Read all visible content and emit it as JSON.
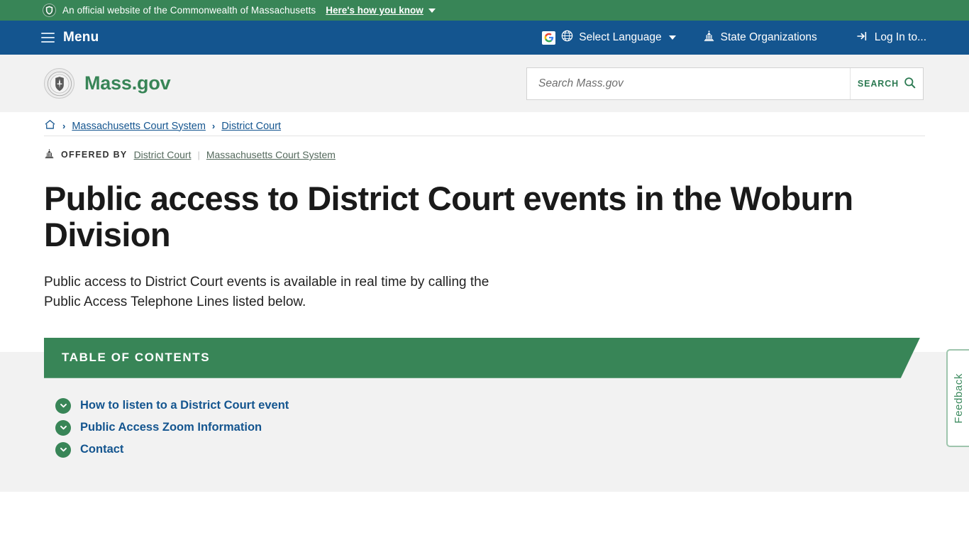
{
  "gov_banner": {
    "shield_icon": "shield-icon",
    "text": "An official website of the Commonwealth of Massachusetts",
    "how_you_know": "Here's how you know",
    "caret_icon": "chevron-down-icon",
    "bg_color": "#388557"
  },
  "util_nav": {
    "menu_label": "Menu",
    "menu_icon": "hamburger-icon",
    "bg_color": "#14558f",
    "google_logo": "G",
    "globe_icon": "globe-icon",
    "select_language": "Select Language",
    "language_caret": "chevron-down-icon",
    "capitol_icon": "capitol-building-icon",
    "state_organizations": "State Organizations",
    "login_icon": "login-arrow-icon",
    "login_label": "Log In to..."
  },
  "header": {
    "seal_icon": "massachusetts-state-seal",
    "brand": "Mass.gov",
    "brand_color": "#388557",
    "search": {
      "placeholder": "Search Mass.gov",
      "value": "",
      "button_label": "SEARCH",
      "button_icon": "magnifier-icon"
    }
  },
  "breadcrumb": {
    "home_icon": "home-icon",
    "separator": "›",
    "items": [
      {
        "label": "Massachusetts Court System"
      },
      {
        "label": "District Court"
      }
    ]
  },
  "offered_by": {
    "icon": "capitol-building-icon",
    "label": "OFFERED BY",
    "links": [
      {
        "label": "District Court"
      },
      {
        "label": "Massachusetts Court System"
      }
    ],
    "divider": "|"
  },
  "main": {
    "title": "Public access to District Court events in the Woburn Division",
    "lede_line1": "Public access to District Court events is available in real time by calling the",
    "lede_line2": "Public Access Telephone Lines listed below."
  },
  "toc": {
    "heading": "TABLE OF CONTENTS",
    "banner_color": "#388557",
    "link_color": "#14558f",
    "items": [
      {
        "label": "How to listen to a District Court event",
        "icon": "chevron-down-circle-icon"
      },
      {
        "label": "Public Access Zoom Information",
        "icon": "chevron-down-circle-icon"
      },
      {
        "label": "Contact",
        "icon": "chevron-down-circle-icon"
      }
    ]
  },
  "feedback": {
    "label": "Feedback",
    "color": "#3d8b5f"
  }
}
